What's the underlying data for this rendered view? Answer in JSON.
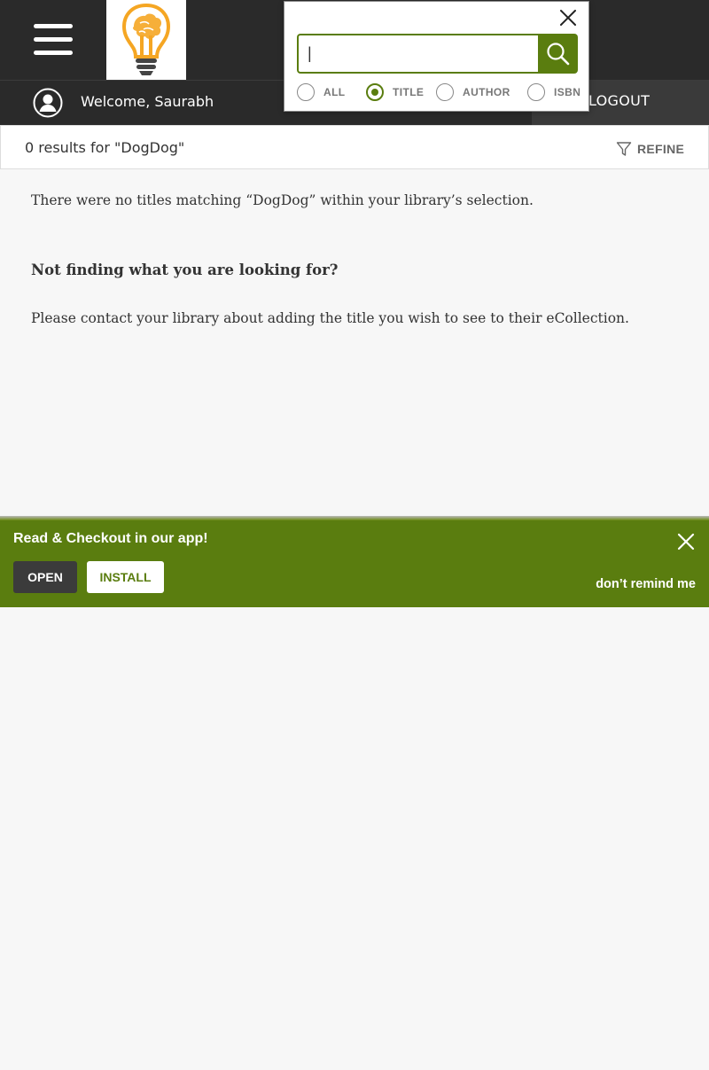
{
  "header": {
    "menu_icon": "hamburger-menu-icon",
    "logo_icon": "lightbulb-brain-logo"
  },
  "userbar": {
    "user_icon": "user-avatar-icon",
    "welcome_text": "Welcome, Saurabh",
    "logout_label": "LOGOUT"
  },
  "results": {
    "summary": "0 results for \"DogDog\"",
    "refine_label": "REFINE",
    "refine_icon": "filter-funnel-icon"
  },
  "main": {
    "no_results_message": "There were no titles matching “DogDog” within your library’s selection.",
    "help_heading": "Not finding what you are looking for?",
    "help_text": "Please contact your library about adding the title you wish to see to their eCollection."
  },
  "app_banner": {
    "title": "Read & Checkout in our app!",
    "open_label": "OPEN",
    "install_label": "INSTALL",
    "dismiss_label": "don’t remind me",
    "close_icon": "close-icon"
  },
  "search_popup": {
    "input_value": "|",
    "search_icon": "search-icon",
    "close_icon": "close-icon",
    "options": [
      {
        "label": "ALL",
        "selected": false
      },
      {
        "label": "TITLE",
        "selected": true
      },
      {
        "label": "AUTHOR",
        "selected": false
      },
      {
        "label": "ISBN",
        "selected": false
      }
    ]
  },
  "colors": {
    "header_bg": "#2a2a2a",
    "accent_green": "#5a7d0f",
    "logo_orange": "#f5a623",
    "page_bg": "#f7f7f7"
  }
}
